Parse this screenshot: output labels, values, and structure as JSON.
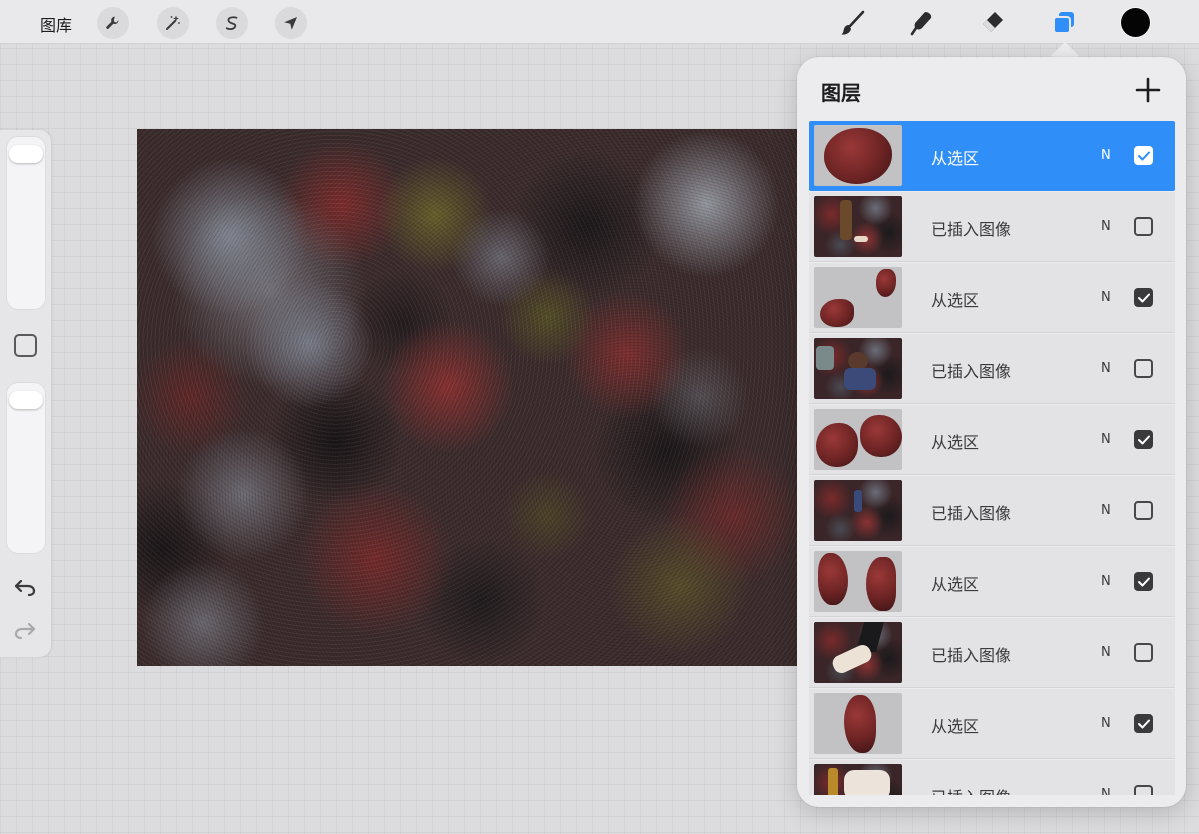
{
  "topbar": {
    "gallery_label": "图库",
    "left_tools": [
      {
        "icon": "wrench-icon",
        "name": "actions"
      },
      {
        "icon": "magic-wand-icon",
        "name": "adjustments"
      },
      {
        "icon": "selection-s-icon",
        "name": "selection"
      },
      {
        "icon": "arrow-cursor-icon",
        "name": "transform"
      }
    ],
    "right_tools": [
      {
        "icon": "brush-icon",
        "name": "paint"
      },
      {
        "icon": "smudge-icon",
        "name": "smudge"
      },
      {
        "icon": "eraser-icon",
        "name": "erase"
      },
      {
        "icon": "layers-icon",
        "name": "layers",
        "active": true
      }
    ],
    "current_color": "#050505",
    "accent_color": "#2f8ef8"
  },
  "sidebar": {
    "size_slider_level": 1.0,
    "opacity_slider_level": 1.0,
    "icons": [
      "modify-square-icon",
      "undo-icon",
      "redo-icon"
    ]
  },
  "layers_panel": {
    "title": "图层",
    "add_icon": "plus-icon",
    "layers": [
      {
        "name": "从选区",
        "blend": "N",
        "visible": true,
        "selected": true
      },
      {
        "name": "已插入图像",
        "blend": "N",
        "visible": false,
        "selected": false
      },
      {
        "name": "从选区",
        "blend": "N",
        "visible": true,
        "selected": false
      },
      {
        "name": "已插入图像",
        "blend": "N",
        "visible": false,
        "selected": false
      },
      {
        "name": "从选区",
        "blend": "N",
        "visible": true,
        "selected": false
      },
      {
        "name": "已插入图像",
        "blend": "N",
        "visible": false,
        "selected": false
      },
      {
        "name": "从选区",
        "blend": "N",
        "visible": true,
        "selected": false
      },
      {
        "name": "已插入图像",
        "blend": "N",
        "visible": false,
        "selected": false
      },
      {
        "name": "从选区",
        "blend": "N",
        "visible": true,
        "selected": false
      },
      {
        "name": "已插入图像",
        "blend": "N",
        "visible": false,
        "selected": false
      }
    ]
  }
}
